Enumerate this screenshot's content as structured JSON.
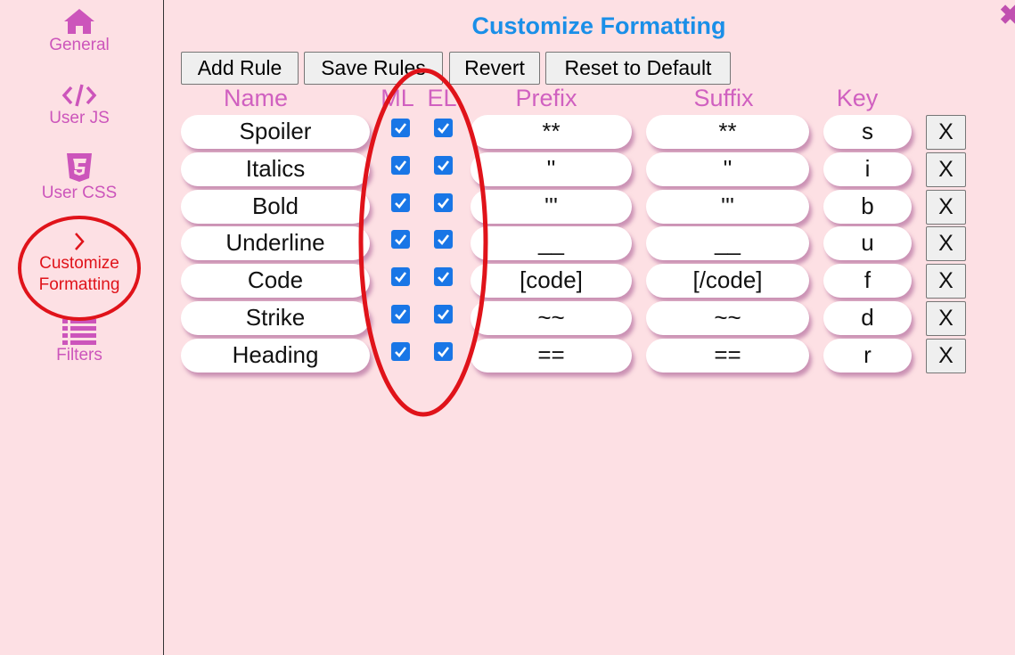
{
  "sidebar": {
    "items": [
      {
        "label": "General",
        "icon": "home-icon"
      },
      {
        "label": "User JS",
        "icon": "code-icon"
      },
      {
        "label": "User CSS",
        "icon": "css3-icon"
      },
      {
        "label_line1": "Customize",
        "label_line2": "Formatting",
        "icon": "chevron-right-icon",
        "active": true
      },
      {
        "label": "Filters",
        "icon": "list-icon"
      }
    ]
  },
  "close_label": "✖",
  "page_title": "Customize Formatting",
  "toolbar": {
    "add_rule": "Add Rule",
    "save_rules": "Save Rules",
    "revert": "Revert",
    "reset_default": "Reset to Default"
  },
  "columns": {
    "name": "Name",
    "ml": "ML",
    "el": "EL",
    "prefix": "Prefix",
    "suffix": "Suffix",
    "key": "Key"
  },
  "rules": [
    {
      "name": "Spoiler",
      "ml": true,
      "el": true,
      "prefix": "**",
      "suffix": "**",
      "key": "s",
      "delete": "X"
    },
    {
      "name": "Italics",
      "ml": true,
      "el": true,
      "prefix": "''",
      "suffix": "''",
      "key": "i",
      "delete": "X"
    },
    {
      "name": "Bold",
      "ml": true,
      "el": true,
      "prefix": "'''",
      "suffix": "'''",
      "key": "b",
      "delete": "X"
    },
    {
      "name": "Underline",
      "ml": true,
      "el": true,
      "prefix": "__",
      "suffix": "__",
      "key": "u",
      "delete": "X"
    },
    {
      "name": "Code",
      "ml": true,
      "el": true,
      "prefix": "[code]",
      "suffix": "[/code]",
      "key": "f",
      "delete": "X"
    },
    {
      "name": "Strike",
      "ml": true,
      "el": true,
      "prefix": "~~",
      "suffix": "~~",
      "key": "d",
      "delete": "X"
    },
    {
      "name": "Heading",
      "ml": true,
      "el": true,
      "prefix": "==",
      "suffix": "==",
      "key": "r",
      "delete": "X"
    }
  ],
  "colors": {
    "background": "#fde0e4",
    "accent_pink": "#cc55bb",
    "title_blue": "#1a8fe8",
    "checkbox_blue": "#1976e6",
    "annotation_red": "#e0131a"
  }
}
